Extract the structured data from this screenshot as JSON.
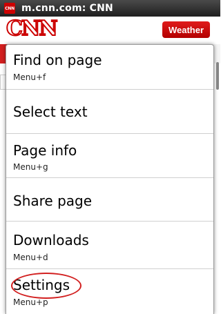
{
  "titlebar": {
    "favicon_text": "CNN",
    "title": "m.cnn.com: CNN"
  },
  "background_page": {
    "logo": "CNN",
    "weather_button": "Weather"
  },
  "menu": {
    "items": [
      {
        "label": "Find on page",
        "shortcut": "Menu+f"
      },
      {
        "label": "Select text",
        "shortcut": ""
      },
      {
        "label": "Page info",
        "shortcut": "Menu+g"
      },
      {
        "label": "Share page",
        "shortcut": ""
      },
      {
        "label": "Downloads",
        "shortcut": "Menu+d"
      },
      {
        "label": "Settings",
        "shortcut": "Menu+p"
      }
    ]
  },
  "colors": {
    "annotation_circle": "#d21f1f",
    "cnn_red": "#cc0000"
  }
}
